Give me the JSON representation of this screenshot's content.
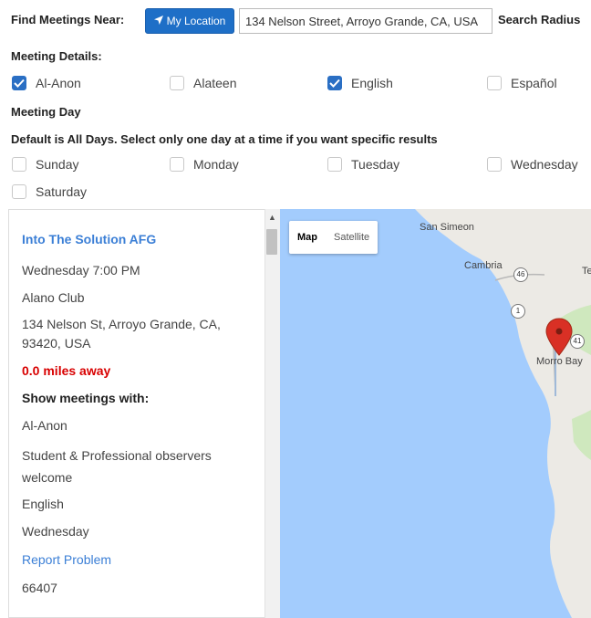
{
  "search": {
    "find_label": "Find Meetings Near:",
    "location_button": "My Location",
    "address_value": "134 Nelson Street, Arroyo Grande, CA, USA",
    "radius_label": "Search Radius"
  },
  "details": {
    "heading": "Meeting Details:",
    "options": [
      {
        "label": "Al-Anon",
        "checked": true
      },
      {
        "label": "Alateen",
        "checked": false
      },
      {
        "label": "English",
        "checked": true
      },
      {
        "label": "Español",
        "checked": false
      }
    ]
  },
  "day": {
    "heading": "Meeting Day",
    "note": "Default is All Days. Select only one day at a time if you want specific results",
    "options": [
      {
        "label": "Sunday",
        "checked": false
      },
      {
        "label": "Monday",
        "checked": false
      },
      {
        "label": "Tuesday",
        "checked": false
      },
      {
        "label": "Wednesday",
        "checked": false
      },
      {
        "label": "Saturday",
        "checked": false
      }
    ]
  },
  "result": {
    "title": "Into The Solution AFG",
    "time": "Wednesday 7:00 PM",
    "venue": "Alano Club",
    "address": "134 Nelson St, Arroyo Grande, CA, 93420, USA",
    "distance": "0.0 miles away",
    "show_heading": "Show meetings with:",
    "tag_alanon": "Al-Anon",
    "tag_observers": "Student & Professional observers welcome",
    "tag_language": "English",
    "tag_day": "Wednesday",
    "report_link": "Report Problem",
    "meeting_id": "66407"
  },
  "map": {
    "map_button": "Map",
    "satellite_button": "Satellite",
    "places": [
      "San Simeon",
      "Cambria",
      "Morro Bay",
      "Te"
    ],
    "roads": [
      "46",
      "1",
      "41"
    ],
    "colors": {
      "water": "#a3ccfd",
      "land": "#eceae5",
      "green": "#cfe8be",
      "pin": "#d93025"
    }
  },
  "colors": {
    "accent": "#1e6fc7",
    "link": "#3b7fd6",
    "distance": "#d80000"
  }
}
